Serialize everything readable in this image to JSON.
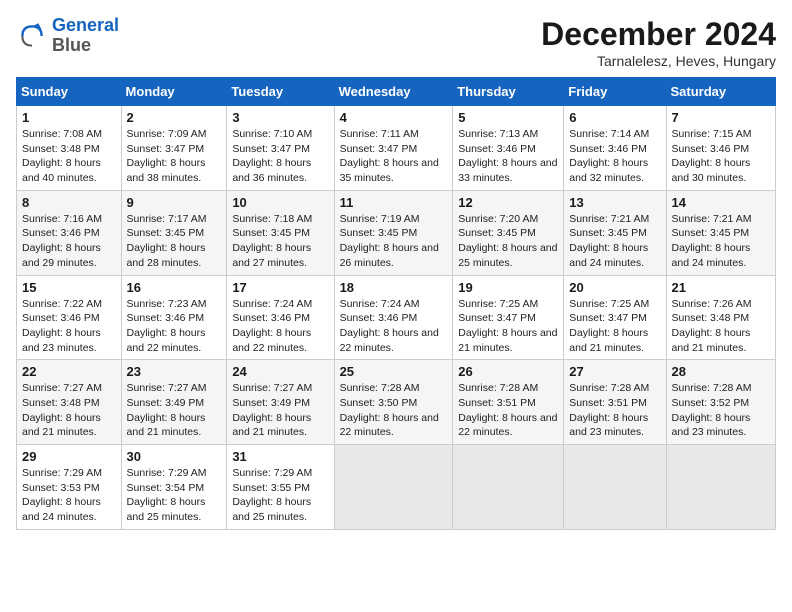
{
  "logo": {
    "line1": "General",
    "line2": "Blue"
  },
  "title": "December 2024",
  "subtitle": "Tarnalelesz, Heves, Hungary",
  "days_of_week": [
    "Sunday",
    "Monday",
    "Tuesday",
    "Wednesday",
    "Thursday",
    "Friday",
    "Saturday"
  ],
  "weeks": [
    [
      {
        "day": "1",
        "sunrise": "7:08 AM",
        "sunset": "3:48 PM",
        "daylight": "8 hours and 40 minutes."
      },
      {
        "day": "2",
        "sunrise": "7:09 AM",
        "sunset": "3:47 PM",
        "daylight": "8 hours and 38 minutes."
      },
      {
        "day": "3",
        "sunrise": "7:10 AM",
        "sunset": "3:47 PM",
        "daylight": "8 hours and 36 minutes."
      },
      {
        "day": "4",
        "sunrise": "7:11 AM",
        "sunset": "3:47 PM",
        "daylight": "8 hours and 35 minutes."
      },
      {
        "day": "5",
        "sunrise": "7:13 AM",
        "sunset": "3:46 PM",
        "daylight": "8 hours and 33 minutes."
      },
      {
        "day": "6",
        "sunrise": "7:14 AM",
        "sunset": "3:46 PM",
        "daylight": "8 hours and 32 minutes."
      },
      {
        "day": "7",
        "sunrise": "7:15 AM",
        "sunset": "3:46 PM",
        "daylight": "8 hours and 30 minutes."
      }
    ],
    [
      {
        "day": "8",
        "sunrise": "7:16 AM",
        "sunset": "3:46 PM",
        "daylight": "8 hours and 29 minutes."
      },
      {
        "day": "9",
        "sunrise": "7:17 AM",
        "sunset": "3:45 PM",
        "daylight": "8 hours and 28 minutes."
      },
      {
        "day": "10",
        "sunrise": "7:18 AM",
        "sunset": "3:45 PM",
        "daylight": "8 hours and 27 minutes."
      },
      {
        "day": "11",
        "sunrise": "7:19 AM",
        "sunset": "3:45 PM",
        "daylight": "8 hours and 26 minutes."
      },
      {
        "day": "12",
        "sunrise": "7:20 AM",
        "sunset": "3:45 PM",
        "daylight": "8 hours and 25 minutes."
      },
      {
        "day": "13",
        "sunrise": "7:21 AM",
        "sunset": "3:45 PM",
        "daylight": "8 hours and 24 minutes."
      },
      {
        "day": "14",
        "sunrise": "7:21 AM",
        "sunset": "3:45 PM",
        "daylight": "8 hours and 24 minutes."
      }
    ],
    [
      {
        "day": "15",
        "sunrise": "7:22 AM",
        "sunset": "3:46 PM",
        "daylight": "8 hours and 23 minutes."
      },
      {
        "day": "16",
        "sunrise": "7:23 AM",
        "sunset": "3:46 PM",
        "daylight": "8 hours and 22 minutes."
      },
      {
        "day": "17",
        "sunrise": "7:24 AM",
        "sunset": "3:46 PM",
        "daylight": "8 hours and 22 minutes."
      },
      {
        "day": "18",
        "sunrise": "7:24 AM",
        "sunset": "3:46 PM",
        "daylight": "8 hours and 22 minutes."
      },
      {
        "day": "19",
        "sunrise": "7:25 AM",
        "sunset": "3:47 PM",
        "daylight": "8 hours and 21 minutes."
      },
      {
        "day": "20",
        "sunrise": "7:25 AM",
        "sunset": "3:47 PM",
        "daylight": "8 hours and 21 minutes."
      },
      {
        "day": "21",
        "sunrise": "7:26 AM",
        "sunset": "3:48 PM",
        "daylight": "8 hours and 21 minutes."
      }
    ],
    [
      {
        "day": "22",
        "sunrise": "7:27 AM",
        "sunset": "3:48 PM",
        "daylight": "8 hours and 21 minutes."
      },
      {
        "day": "23",
        "sunrise": "7:27 AM",
        "sunset": "3:49 PM",
        "daylight": "8 hours and 21 minutes."
      },
      {
        "day": "24",
        "sunrise": "7:27 AM",
        "sunset": "3:49 PM",
        "daylight": "8 hours and 21 minutes."
      },
      {
        "day": "25",
        "sunrise": "7:28 AM",
        "sunset": "3:50 PM",
        "daylight": "8 hours and 22 minutes."
      },
      {
        "day": "26",
        "sunrise": "7:28 AM",
        "sunset": "3:51 PM",
        "daylight": "8 hours and 22 minutes."
      },
      {
        "day": "27",
        "sunrise": "7:28 AM",
        "sunset": "3:51 PM",
        "daylight": "8 hours and 23 minutes."
      },
      {
        "day": "28",
        "sunrise": "7:28 AM",
        "sunset": "3:52 PM",
        "daylight": "8 hours and 23 minutes."
      }
    ],
    [
      {
        "day": "29",
        "sunrise": "7:29 AM",
        "sunset": "3:53 PM",
        "daylight": "8 hours and 24 minutes."
      },
      {
        "day": "30",
        "sunrise": "7:29 AM",
        "sunset": "3:54 PM",
        "daylight": "8 hours and 25 minutes."
      },
      {
        "day": "31",
        "sunrise": "7:29 AM",
        "sunset": "3:55 PM",
        "daylight": "8 hours and 25 minutes."
      },
      null,
      null,
      null,
      null
    ]
  ]
}
